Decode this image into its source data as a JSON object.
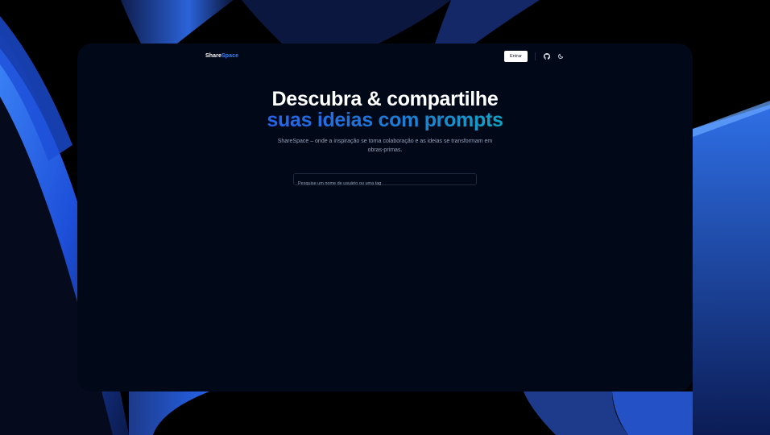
{
  "brand": {
    "name_part1": "Share",
    "name_part2": "Space"
  },
  "nav": {
    "login_label": "Entrar",
    "icons": [
      "github-icon",
      "theme-toggle-icon"
    ]
  },
  "hero": {
    "headline_line1": "Descubra & compartilhe",
    "headline_line2": "suas ideias com prompts",
    "subtitle": "ShareSpace – onde a inspiração se torna colaboração e as ideias se transformam em obras-primas."
  },
  "search": {
    "placeholder": "Pesquise um nome de usuário ou uma tag",
    "value": ""
  },
  "colors": {
    "window_bg": "#010817",
    "accent": "#3b82f6",
    "gradient_start": "#2563eb",
    "gradient_end": "#0ea5c6"
  }
}
